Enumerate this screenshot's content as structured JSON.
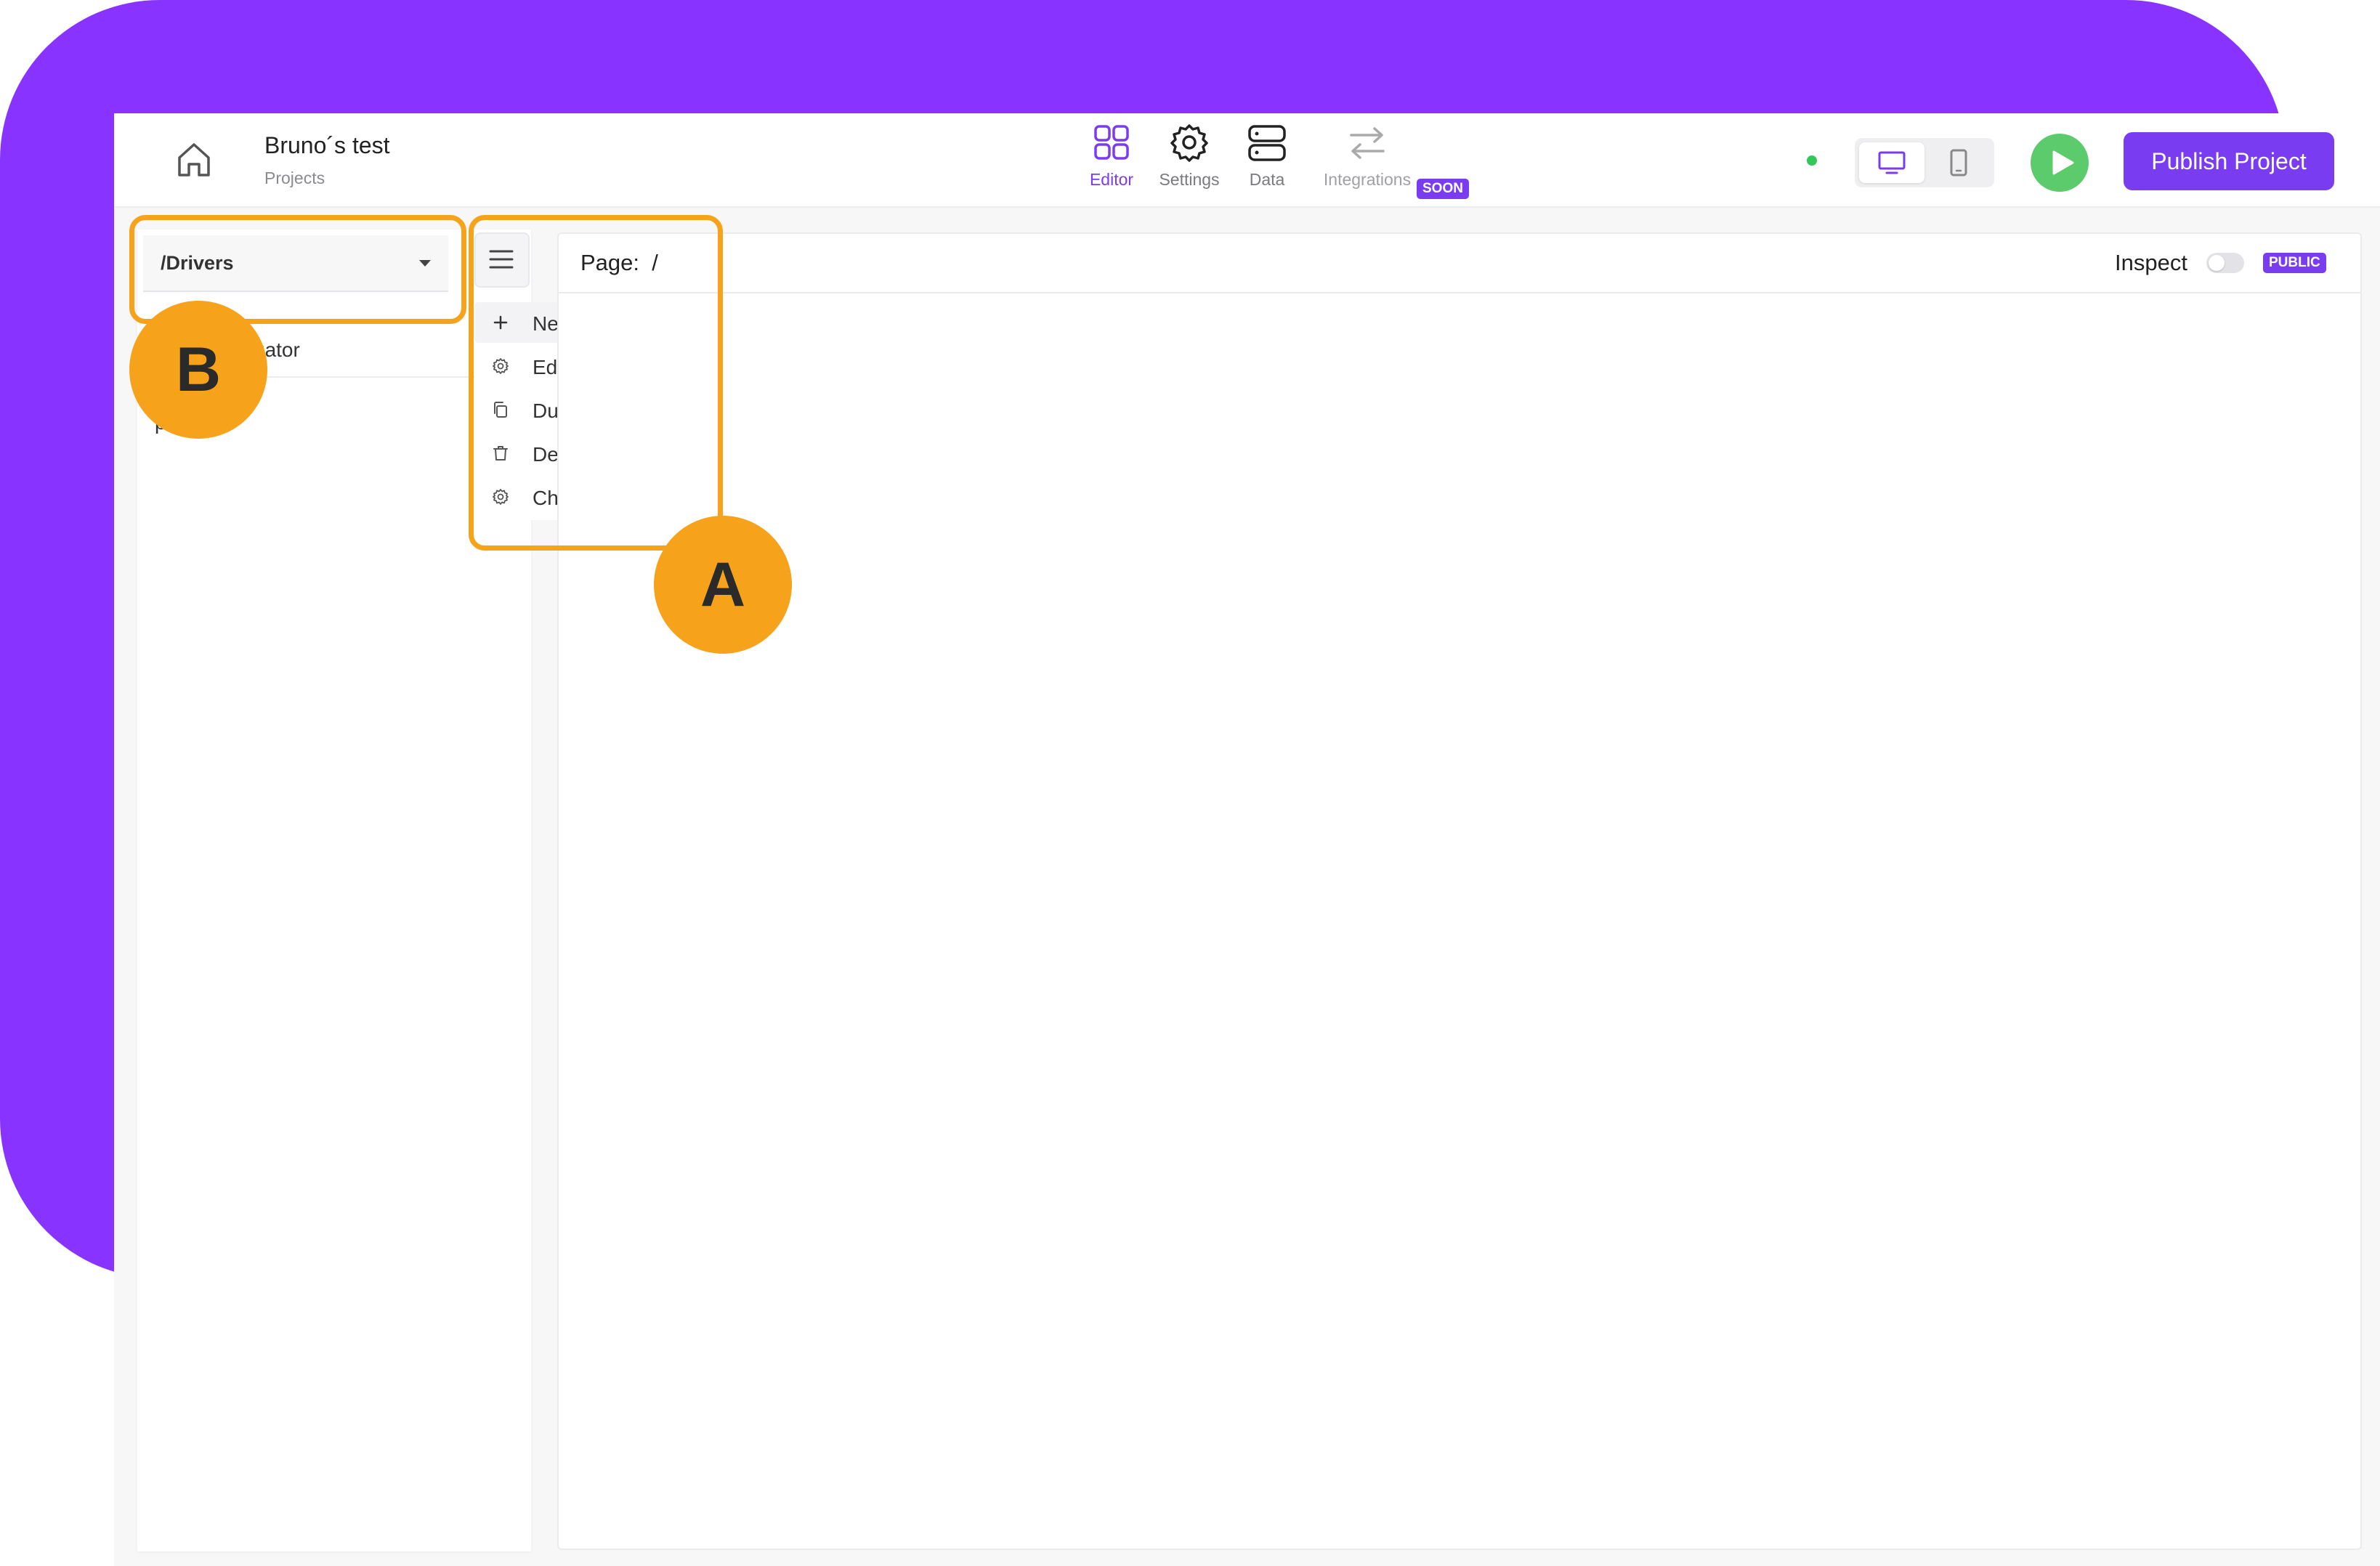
{
  "header": {
    "project_title": "Bruno´s test",
    "project_subtitle": "Projects",
    "nav": [
      {
        "label": "Editor",
        "icon": "grid-icon",
        "active": true
      },
      {
        "label": "Settings",
        "icon": "gear-icon"
      },
      {
        "label": "Data",
        "icon": "database-icon"
      },
      {
        "label": "Integrations",
        "icon": "arrows-swap-icon",
        "badge": "SOON"
      }
    ],
    "publish_label": "Publish Project"
  },
  "left_panel": {
    "page_select_value": "/Drivers",
    "tree_title": "gator",
    "tree_item": "page"
  },
  "page_menu": {
    "items": [
      {
        "label": "New page",
        "icon": "plus-icon"
      },
      {
        "label": "Edit page",
        "icon": "gear-icon"
      },
      {
        "label": "Duplicate page",
        "icon": "copy-icon"
      },
      {
        "label": "Delete page",
        "icon": "trash-icon"
      },
      {
        "label": "Change layout",
        "icon": "gear-icon"
      }
    ]
  },
  "canvas": {
    "page_label": "Page:",
    "page_path": "/",
    "inspect_label": "Inspect",
    "public_badge": "PUBLIC"
  },
  "annotations": {
    "a": "A",
    "b": "B"
  },
  "colors": {
    "accent": "#7a3cf0",
    "background_purple": "#8833ff",
    "highlight": "#f6a31b",
    "play_green": "#5ccb6b"
  }
}
